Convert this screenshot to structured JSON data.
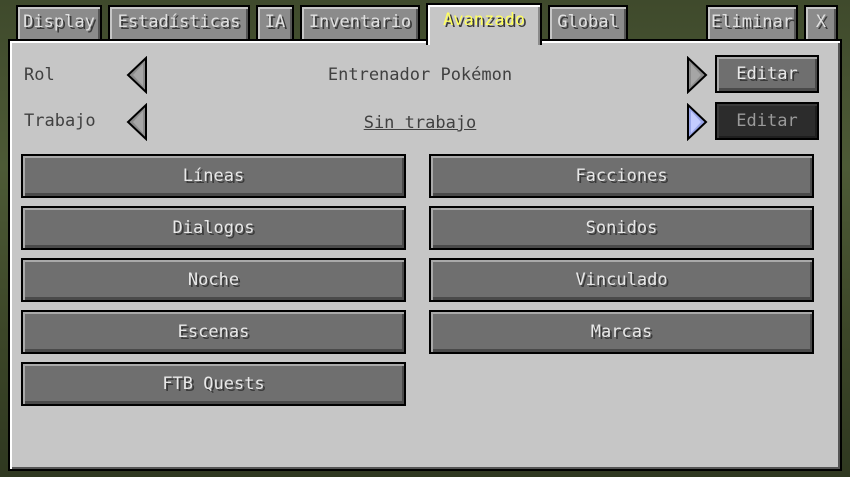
{
  "tabs": [
    {
      "label": "Display",
      "active": false
    },
    {
      "label": "Estadísticas",
      "active": false
    },
    {
      "label": "IA",
      "active": false
    },
    {
      "label": "Inventario",
      "active": false
    },
    {
      "label": "Avanzado",
      "active": true
    },
    {
      "label": "Global",
      "active": false
    },
    {
      "label": "Eliminar",
      "active": false
    },
    {
      "label": "X",
      "active": false
    }
  ],
  "role": {
    "label": "Rol",
    "value": "Entrenador Pokémon",
    "edit_label": "Editar"
  },
  "job": {
    "label": "Trabajo",
    "value": "Sin trabajo",
    "edit_label": "Editar"
  },
  "buttons_left": [
    "Líneas",
    "Dialogos",
    "Noche",
    "Escenas",
    "FTB Quests"
  ],
  "buttons_right": [
    "Facciones",
    "Sonidos",
    "Vinculado",
    "Marcas"
  ],
  "colors": {
    "panel": "#c6c6c6",
    "button": "#6f6f6f",
    "active_tab_text": "#ffff60",
    "arrow_highlight": "#9aa6e8"
  }
}
